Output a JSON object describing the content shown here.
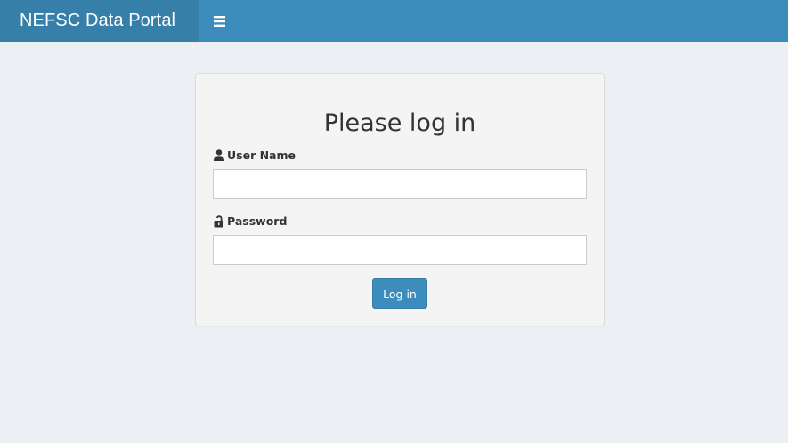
{
  "header": {
    "brand_title": "NEFSC Data Portal",
    "menu_icon": "hamburger-menu-icon",
    "bar_color": "#3c8dbc",
    "brand_color": "#367fa9"
  },
  "login": {
    "title": "Please log in",
    "username": {
      "label": "User Name",
      "icon": "user-icon",
      "value": "",
      "placeholder": ""
    },
    "password": {
      "label": "Password",
      "icon": "unlock-icon",
      "value": "",
      "placeholder": ""
    },
    "submit_label": "Log in"
  },
  "colors": {
    "page_background": "#ecf0f5",
    "panel_background": "#f4f4f4",
    "accent": "#3c8dbc"
  }
}
